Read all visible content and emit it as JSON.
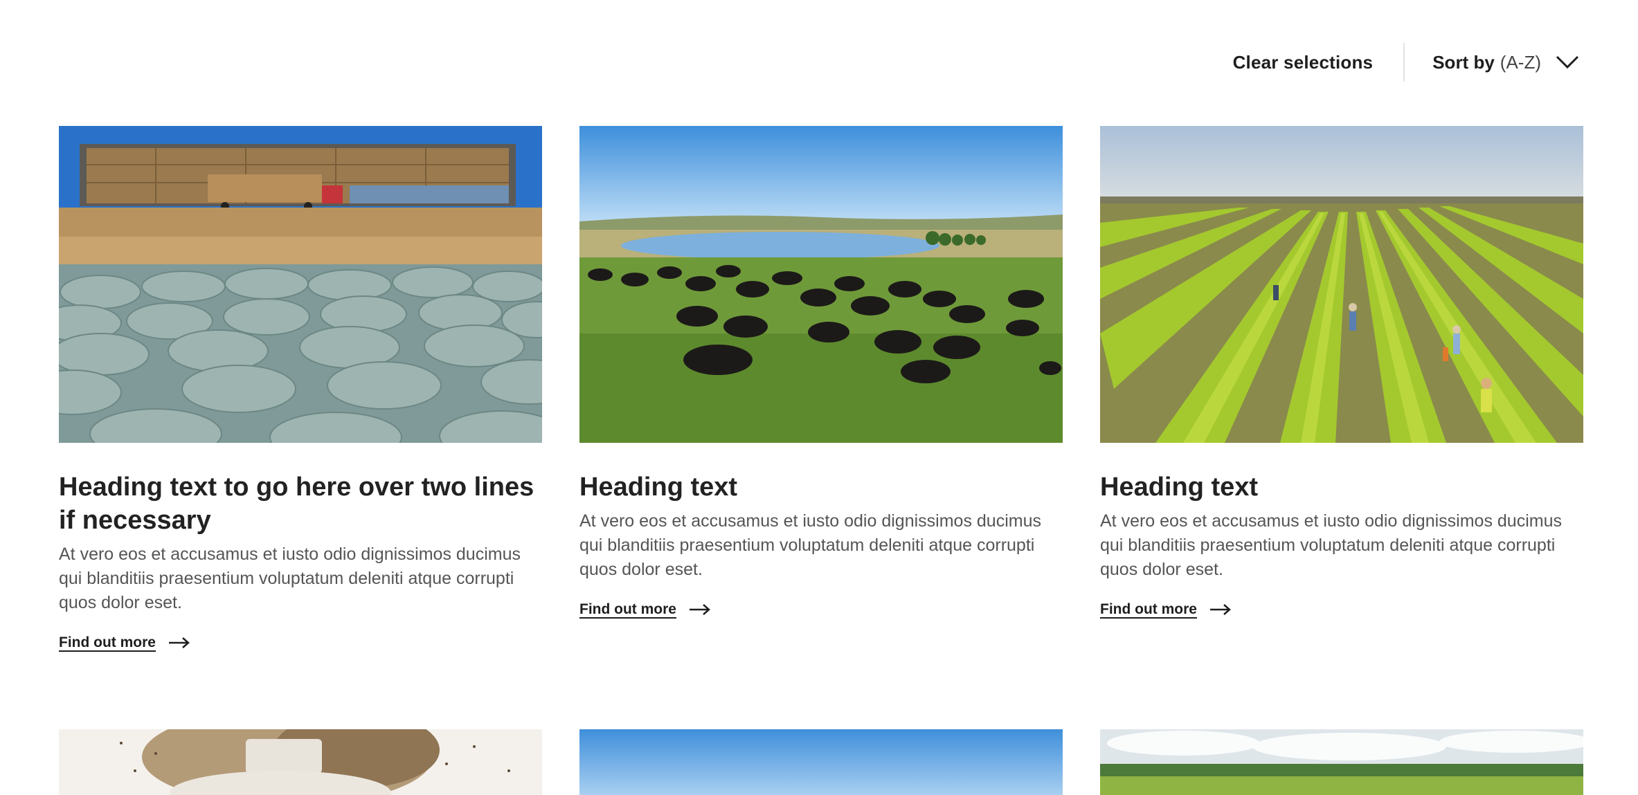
{
  "toolbar": {
    "clear_label": "Clear selections",
    "sort_label": "Sort by",
    "sort_value": "(A-Z)",
    "chevron_icon": "chevron-down-icon"
  },
  "cards": [
    {
      "title": "Heading text to go here over two lines if necessary",
      "description": "At vero eos et accusamus et iusto odio dignissimos ducimus qui blanditiis praesentium voluptatum deleniti atque corrupti quos dolor eset.",
      "link_label": "Find out more",
      "image": "hay-bales-field-photo"
    },
    {
      "title": "Heading text",
      "description": "At vero eos et accusamus et iusto odio dignissimos ducimus qui blanditiis praesentium voluptatum deleniti atque corrupti quos dolor eset.",
      "link_label": "Find out more",
      "image": "cattle-grazing-lake-photo"
    },
    {
      "title": "Heading text",
      "description": "At vero eos et accusamus et iusto odio dignissimos ducimus qui blanditiis praesentium voluptatum deleniti atque corrupti quos dolor eset.",
      "link_label": "Find out more",
      "image": "vineyard-workers-photo"
    }
  ],
  "row2_images": [
    "farmer-hat-photo",
    "blue-sky-photo",
    "green-field-clouds-photo"
  ],
  "colors": {
    "text_dark": "#1e1e1e",
    "text_body": "#555555",
    "divider": "#e2e2e2"
  }
}
